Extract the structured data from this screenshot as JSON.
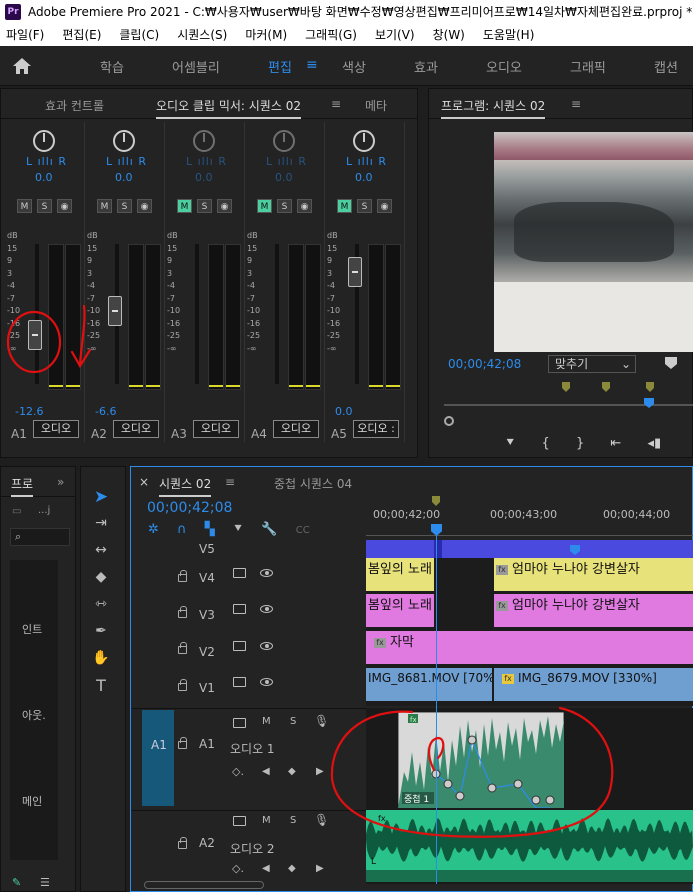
{
  "title_bar": {
    "app_icon": "Pr",
    "title": "Adobe Premiere Pro 2021 - C:₩사용자₩user₩바탕 화면₩수정₩영상편집₩프리미어프로₩14일차₩자체편집완료.prproj *"
  },
  "menu": [
    "파일(F)",
    "편집(E)",
    "클립(C)",
    "시퀀스(S)",
    "마커(M)",
    "그래픽(G)",
    "보기(V)",
    "창(W)",
    "도움말(H)"
  ],
  "workspaces": {
    "items": [
      "학습",
      "어셈블리",
      "편집",
      "색상",
      "효과",
      "오디오",
      "그래픽",
      "캡션"
    ],
    "active": "편집"
  },
  "mixer_panel": {
    "tabs": [
      "효과 컨트롤",
      "오디오 클립 믹서: 시퀀스 02",
      "메타"
    ],
    "active_tab": "오디오 클립 믹서: 시퀀스 02",
    "db_scale": [
      "dB",
      "15",
      "9",
      "3",
      "-4",
      "-7",
      "-10",
      "-16",
      "-25",
      "-∞"
    ],
    "tracks": [
      {
        "id": "A1",
        "lr": "L ıllı R",
        "pan": "0.0",
        "volume": "-12.6",
        "level": 0.35,
        "name": "오디오",
        "m_on": false,
        "dim": false
      },
      {
        "id": "A2",
        "lr": "L ıllı R",
        "pan": "0.0",
        "volume": "-6.6",
        "level": 0.52,
        "name": "오디오",
        "m_on": false,
        "dim": false
      },
      {
        "id": "A3",
        "lr": "L ıllı R",
        "pan": "0.0",
        "volume": "",
        "level": 0,
        "name": "오디오",
        "m_on": true,
        "dim": true
      },
      {
        "id": "A4",
        "lr": "L ıllı R",
        "pan": "0.0",
        "volume": "",
        "level": 0,
        "name": "오디오",
        "m_on": true,
        "dim": true
      },
      {
        "id": "A5",
        "lr": "L ıllı R",
        "pan": "0.0",
        "volume": "0.0",
        "level": 0.8,
        "name": "오디오 :",
        "m_on": true,
        "dim": false
      }
    ],
    "ms_labels": [
      "M",
      "S",
      "◉"
    ]
  },
  "program_panel": {
    "title": "프로그램: 시퀀스 02",
    "timecode": "00;00;42;08",
    "fit": "맞추기"
  },
  "project_panel": {
    "tab": "프로",
    "items": [
      "인트",
      "아웃.",
      "메인"
    ],
    "bin_label": "...j"
  },
  "timeline": {
    "tabs": [
      "시퀀스 02",
      "중첩 시퀀스 04"
    ],
    "active_tab": "시퀀스 02",
    "timecode": "00;00;42;08",
    "ruler": [
      "00;00;42;00",
      "00;00;43;00",
      "00;00;44;00"
    ],
    "video_tracks": [
      {
        "label": "V5"
      },
      {
        "label": "V4"
      },
      {
        "label": "V3"
      },
      {
        "label": "V2"
      },
      {
        "label": "V1"
      }
    ],
    "audio_tracks": [
      {
        "id": "A1",
        "label": "A1",
        "name": "오디오 1",
        "m": "M",
        "s": "S"
      },
      {
        "id": "A2",
        "label": "A2",
        "name": "오디오 2",
        "m": "M",
        "s": "S"
      }
    ],
    "clips": {
      "v4_left": "봄잎의 노래",
      "v4_right": "엄마야 누나야 강변살자",
      "v3_left": "봄잎의 노래",
      "v3_right": "엄마야 누나야 강변살자",
      "v2": "자막",
      "v1_left": "IMG_8681.MOV [70%]",
      "v1_right": "IMG_8679.MOV [330%]",
      "a1_nested": "중첩 1"
    },
    "fx_badge": "fx"
  },
  "colors": {
    "accent": "#2d8ceb",
    "clip_yellow": "#e8e27a",
    "clip_pink": "#e07ae0",
    "clip_blue_video": "#6f9ed0",
    "audio_green": "#29c28a",
    "annotation_red": "#e01010"
  }
}
